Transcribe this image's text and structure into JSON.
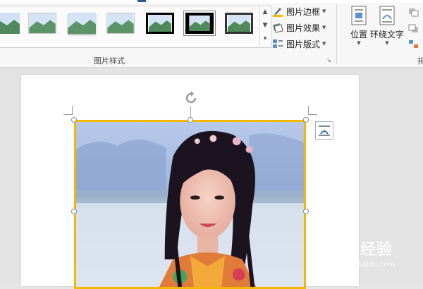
{
  "ribbon": {
    "picture_styles_group": {
      "label": "图片样式",
      "gallery_styles": [
        "simple-frame",
        "soft-edge-white",
        "reflected-bevel",
        "soft-shadow",
        "thick-black-frame",
        "black-frame-selected",
        "simple-frame-black"
      ],
      "commands": [
        {
          "label": "图片边框",
          "icon": "picture-border-icon"
        },
        {
          "label": "图片效果",
          "icon": "picture-effects-icon"
        },
        {
          "label": "图片版式",
          "icon": "picture-layout-icon"
        }
      ]
    },
    "arrange_group": {
      "buttons": [
        {
          "label": "位置",
          "icon": "position-icon"
        },
        {
          "label": "环绕文字",
          "icon": "wrap-text-icon"
        }
      ],
      "label_fragment": "排"
    }
  },
  "watermark": {
    "main": "Bai 经验",
    "sub": "jingyan.baidu.com"
  },
  "colors": {
    "selection_border": "#f5b800",
    "accent_blue": "#2b579a"
  }
}
